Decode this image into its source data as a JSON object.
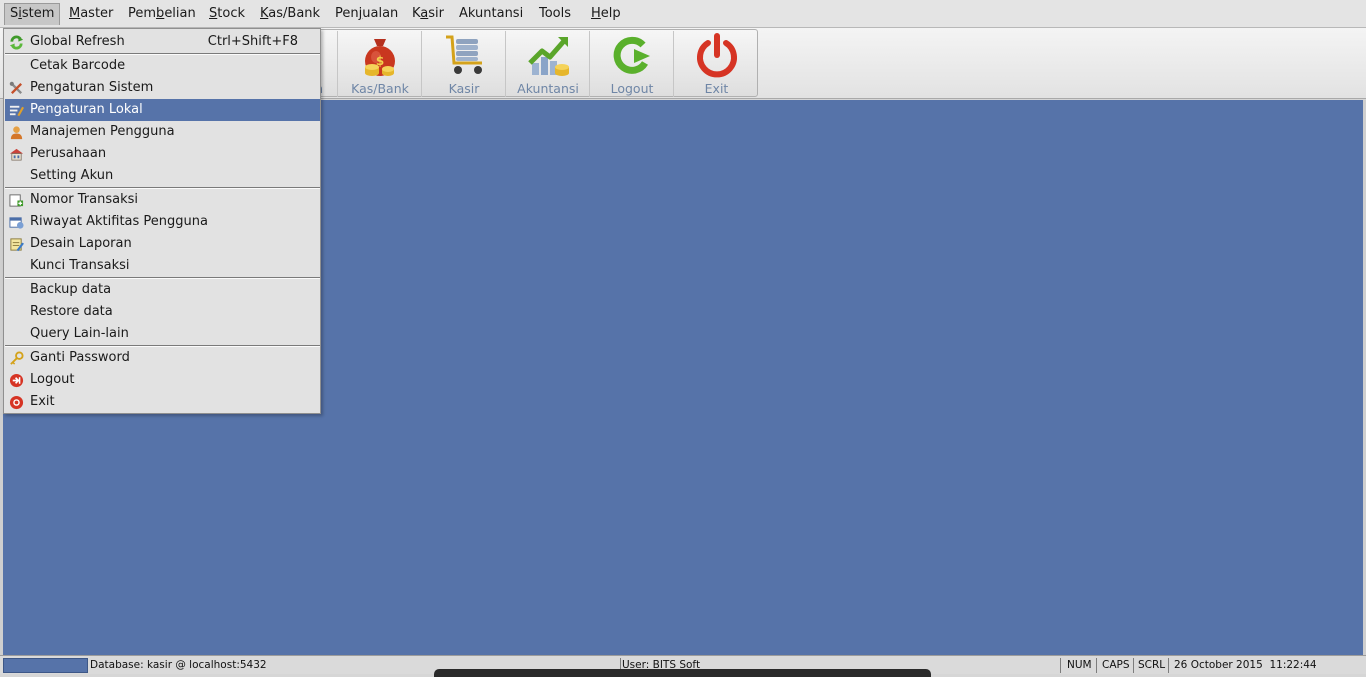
{
  "menubar": {
    "items": [
      {
        "label": "Sistem",
        "mnemonic": "i"
      },
      {
        "label": "Master",
        "mnemonic": "M"
      },
      {
        "label": "Pembelian",
        "mnemonic": "b"
      },
      {
        "label": "Stock",
        "mnemonic": "S"
      },
      {
        "label": "Kas/Bank",
        "mnemonic": "K"
      },
      {
        "label": "Penjualan",
        "mnemonic": "j"
      },
      {
        "label": "Kasir",
        "mnemonic": "a"
      },
      {
        "label": "Akuntansi",
        "mnemonic": ""
      },
      {
        "label": "Tools",
        "mnemonic": ""
      },
      {
        "label": "Help",
        "mnemonic": "H"
      }
    ],
    "active": "Sistem"
  },
  "toolbar": {
    "partial_label": "n",
    "buttons": [
      {
        "label": "Kas/Bank",
        "icon": "money-bag-icon"
      },
      {
        "label": "Kasir",
        "icon": "cashier-cart-icon"
      },
      {
        "label": "Akuntansi",
        "icon": "chart-up-icon"
      },
      {
        "label": "Logout",
        "icon": "logout-arrow-icon"
      },
      {
        "label": "Exit",
        "icon": "power-icon"
      }
    ]
  },
  "sistem_menu": {
    "items": [
      {
        "label": "Global Refresh",
        "accel": "Ctrl+Shift+F8",
        "icon": "refresh-icon"
      },
      {
        "label": "Cetak Barcode",
        "icon": ""
      },
      {
        "label": "Pengaturan Sistem",
        "icon": "tools-icon"
      },
      {
        "label": "Pengaturan Lokal",
        "icon": "edit-icon",
        "selected": true
      },
      {
        "label": "Manajemen Pengguna",
        "icon": "user-icon"
      },
      {
        "label": "Perusahaan",
        "icon": "building-icon"
      },
      {
        "label": "Setting Akun",
        "icon": ""
      },
      {
        "label": "Nomor Transaksi",
        "icon": "add-document-icon"
      },
      {
        "label": "Riwayat Aktifitas Pengguna",
        "icon": "history-icon"
      },
      {
        "label": "Desain Laporan",
        "icon": "report-design-icon"
      },
      {
        "label": "Kunci Transaksi",
        "icon": ""
      },
      {
        "label": "Backup data",
        "icon": ""
      },
      {
        "label": "Restore data",
        "icon": ""
      },
      {
        "label": "Query Lain-lain",
        "icon": ""
      },
      {
        "label": "Ganti Password",
        "icon": "key-icon"
      },
      {
        "label": "Logout",
        "icon": "logout-icon"
      },
      {
        "label": "Exit",
        "icon": "exit-icon"
      }
    ]
  },
  "statusbar": {
    "database": "Database: kasir @ localhost:5432",
    "user": "User: BITS Soft",
    "num": "NUM",
    "caps": "CAPS",
    "scrl": "SCRL",
    "datetime": "26 October 2015  11:22:44"
  },
  "colors": {
    "desktop": "#5673a9",
    "selection": "#5673a9",
    "toolbar_label": "#6f86a6"
  }
}
